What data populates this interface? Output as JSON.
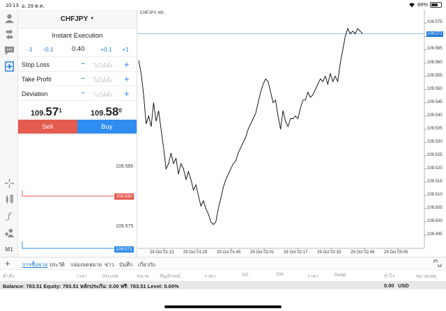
{
  "status_bar": {
    "time": "10:13",
    "date": "อ. 29 ต.ค.",
    "battery_pct": "69%",
    "battery_level": 0.69
  },
  "trade": {
    "symbol": "CHFJPY",
    "execution": "Instant Execution",
    "volume_steps": {
      "minus_big": "-1",
      "minus_small": "-0.1",
      "value": "0.40",
      "plus_small": "+0.1",
      "plus_big": "+1"
    },
    "params": [
      {
        "label": "Stop Loss",
        "placeholder": "ไม่ได้ตั้ง"
      },
      {
        "label": "Take Profit",
        "placeholder": "ไม่ได้ตั้ง"
      },
      {
        "label": "Deviation",
        "placeholder": "ไม่ได้ตั้ง"
      }
    ],
    "minus_sign": "−",
    "plus_sign": "+",
    "bid": {
      "main": "109.",
      "big": "57",
      "sup": "1"
    },
    "ask": {
      "main": "109.",
      "big": "58",
      "sup": "0"
    },
    "sell_label": "Sell",
    "buy_label": "Buy",
    "depth": {
      "upper_label": "109.585",
      "sell_tag": "109.580",
      "lower_label": "109.575",
      "buy_tag": "109.571"
    }
  },
  "toolbar": {
    "timeframe": "M1"
  },
  "chart": {
    "title": "CHFJPY, M1",
    "current_price_tag": "109.571"
  },
  "chart_data": {
    "type": "line",
    "title": "CHFJPY, M1",
    "y_ticks": [
      "109.575",
      "109.570",
      "109.565",
      "109.560",
      "109.555",
      "109.550",
      "109.545",
      "109.540",
      "109.535",
      "109.530",
      "109.525",
      "109.520",
      "109.515",
      "109.510",
      "109.505",
      "109.500",
      "109.495"
    ],
    "x_ticks": [
      "29 Oct 01:13",
      "29 Oct 01:29",
      "29 Oct 01:45",
      "29 Oct 02:01",
      "29 Oct 02:17",
      "29 Oct 02:33",
      "29 Oct 02:49",
      "29 Oct 03:05"
    ],
    "ylim": [
      109.49,
      109.578
    ],
    "current_price": 109.571,
    "x": [
      0,
      1,
      2,
      3,
      4,
      5,
      6,
      7,
      8,
      9,
      10,
      11,
      12,
      13,
      14,
      15,
      16,
      17,
      18,
      19,
      20,
      21,
      22,
      23,
      24,
      25,
      26,
      27,
      28,
      29,
      30,
      31,
      32,
      33,
      34,
      35,
      36,
      37,
      38,
      39,
      40,
      41,
      42,
      43,
      44,
      45,
      46,
      47,
      48,
      49,
      50,
      51,
      52,
      53,
      54,
      55,
      56,
      57,
      58,
      59,
      60,
      61,
      62,
      63,
      64,
      65,
      66,
      67,
      68,
      69,
      70,
      71,
      72,
      73,
      74,
      75,
      76,
      77,
      78,
      79,
      80,
      81,
      82,
      83,
      84,
      85,
      86,
      87,
      88,
      89,
      90,
      91,
      92,
      93,
      94,
      95,
      96,
      97,
      98,
      99,
      100,
      101,
      102,
      103,
      104,
      105,
      106,
      107,
      108,
      109,
      110,
      111,
      112
    ],
    "y": [
      109.561,
      109.556,
      109.548,
      109.537,
      109.54,
      109.536,
      109.545,
      109.538,
      109.542,
      109.535,
      109.528,
      109.52,
      109.522,
      109.526,
      109.522,
      109.524,
      109.518,
      109.522,
      109.52,
      109.516,
      109.519,
      109.516,
      109.512,
      109.514,
      109.51,
      109.506,
      109.508,
      109.505,
      109.503,
      109.5,
      109.499,
      109.5,
      109.505,
      109.509,
      109.513,
      109.516,
      109.518,
      109.52,
      109.522,
      109.523,
      109.526,
      109.528,
      109.53,
      109.532,
      109.535,
      109.537,
      109.539,
      109.541,
      109.545,
      109.549,
      109.552,
      109.554,
      109.553,
      109.549,
      109.545,
      109.546,
      109.54,
      109.535,
      109.542,
      109.538,
      109.536,
      109.539,
      109.539,
      109.54,
      109.539,
      109.543,
      109.546,
      109.546,
      109.549,
      109.547,
      109.548,
      109.55,
      109.552,
      109.554,
      109.553,
      109.555,
      109.552,
      109.556,
      109.553,
      109.555,
      109.553,
      109.56,
      109.565,
      109.57,
      109.573,
      109.571,
      109.572,
      109.571,
      109.573,
      109.572,
      109.571
    ],
    "series_name": "",
    "grid": false
  },
  "bottom": {
    "tabs": [
      "การซื้อขาย",
      "ประวัติ",
      "กล่องจดหมาย",
      "ข่าว",
      "บันทึก",
      "เกี่ยวกับ"
    ],
    "columns": [
      "คำสั่ง",
      "เวลา",
      "ประเภท",
      "ขนาด",
      "สัญลักษณ์",
      "ราคา",
      "S/L",
      "T/P",
      "ราคา",
      "Swap",
      "กำไร",
      "หมายเหตุ"
    ],
    "balance_line": "Balance: 783.51 Equity: 783.51 หลักประกัน: 0.00 ฟรี: 783.51 Level: 0.00%",
    "total_profit": "0.00",
    "currency": "USD"
  },
  "colors": {
    "accent": "#1f7ad9",
    "sell": "#e45b4f",
    "buy": "#2f8cf0"
  }
}
